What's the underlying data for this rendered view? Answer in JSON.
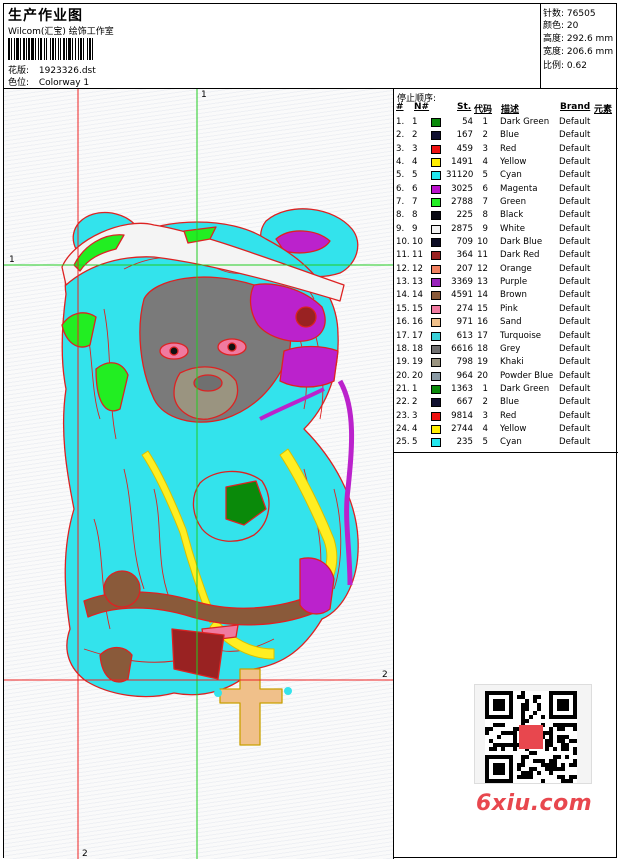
{
  "header": {
    "title": "生产作业图",
    "company": "Wilcom(汇宝) 绘饰工作室",
    "design_label": "花版:",
    "design_value": "1923326.dst",
    "colorway_label": "色位:",
    "colorway_value": "Colorway 1"
  },
  "stats": [
    {
      "label": "针数:",
      "value": "76505"
    },
    {
      "label": "颜色:",
      "value": "20"
    },
    {
      "label": "高度:",
      "value": "292.6 mm"
    },
    {
      "label": "宽度:",
      "value": "206.6 mm"
    },
    {
      "label": "比例:",
      "value": "0.62"
    }
  ],
  "markers": {
    "v1": "1",
    "h1": "1",
    "h2": "2",
    "v2": "2"
  },
  "stop_sequence": {
    "title": "停止顺序:",
    "headers": [
      "#",
      "N#",
      "St.",
      "代码",
      "描述",
      "Brand",
      "元素"
    ],
    "rows": [
      {
        "idx": "1.",
        "n": "1",
        "color": "#0a8a0a",
        "st": "54",
        "code": "1",
        "desc": "Dark Green",
        "brand": "Default"
      },
      {
        "idx": "2.",
        "n": "2",
        "color": "#101030",
        "st": "167",
        "code": "2",
        "desc": "Blue",
        "brand": "Default"
      },
      {
        "idx": "3.",
        "n": "3",
        "color": "#ee1111",
        "st": "459",
        "code": "3",
        "desc": "Red",
        "brand": "Default"
      },
      {
        "idx": "4.",
        "n": "4",
        "color": "#ffee00",
        "st": "1491",
        "code": "4",
        "desc": "Yellow",
        "brand": "Default"
      },
      {
        "idx": "5.",
        "n": "5",
        "color": "#22e6ee",
        "st": "31120",
        "code": "5",
        "desc": "Cyan",
        "brand": "Default"
      },
      {
        "idx": "6.",
        "n": "6",
        "color": "#bb11cc",
        "st": "3025",
        "code": "6",
        "desc": "Magenta",
        "brand": "Default"
      },
      {
        "idx": "7.",
        "n": "7",
        "color": "#22ee22",
        "st": "2788",
        "code": "7",
        "desc": "Green",
        "brand": "Default"
      },
      {
        "idx": "8.",
        "n": "8",
        "color": "#0a0a14",
        "st": "225",
        "code": "8",
        "desc": "Black",
        "brand": "Default"
      },
      {
        "idx": "9.",
        "n": "9",
        "color": "#f4f4f4",
        "st": "2875",
        "code": "9",
        "desc": "White",
        "brand": "Default"
      },
      {
        "idx": "10.",
        "n": "10",
        "color": "#0c0c24",
        "st": "709",
        "code": "10",
        "desc": "Dark Blue",
        "brand": "Default"
      },
      {
        "idx": "11.",
        "n": "11",
        "color": "#992222",
        "st": "364",
        "code": "11",
        "desc": "Dark Red",
        "brand": "Default"
      },
      {
        "idx": "12.",
        "n": "12",
        "color": "#f08060",
        "st": "207",
        "code": "12",
        "desc": "Orange",
        "brand": "Default"
      },
      {
        "idx": "13.",
        "n": "13",
        "color": "#9922bb",
        "st": "3369",
        "code": "13",
        "desc": "Purple",
        "brand": "Default"
      },
      {
        "idx": "14.",
        "n": "14",
        "color": "#8a5a3a",
        "st": "4591",
        "code": "14",
        "desc": "Brown",
        "brand": "Default"
      },
      {
        "idx": "15.",
        "n": "15",
        "color": "#f07aa0",
        "st": "274",
        "code": "15",
        "desc": "Pink",
        "brand": "Default"
      },
      {
        "idx": "16.",
        "n": "16",
        "color": "#f0c08a",
        "st": "971",
        "code": "16",
        "desc": "Sand",
        "brand": "Default"
      },
      {
        "idx": "17.",
        "n": "17",
        "color": "#3ad0d8",
        "st": "613",
        "code": "17",
        "desc": "Turquoise",
        "brand": "Default"
      },
      {
        "idx": "18.",
        "n": "18",
        "color": "#707070",
        "st": "6616",
        "code": "18",
        "desc": "Grey",
        "brand": "Default"
      },
      {
        "idx": "19.",
        "n": "19",
        "color": "#9a9480",
        "st": "798",
        "code": "19",
        "desc": "Khaki",
        "brand": "Default"
      },
      {
        "idx": "20.",
        "n": "20",
        "color": "#8a9aa4",
        "st": "964",
        "code": "20",
        "desc": "Powder Blue",
        "brand": "Default"
      },
      {
        "idx": "21.",
        "n": "1",
        "color": "#0a8a0a",
        "st": "1363",
        "code": "1",
        "desc": "Dark Green",
        "brand": "Default"
      },
      {
        "idx": "22.",
        "n": "2",
        "color": "#101030",
        "st": "667",
        "code": "2",
        "desc": "Blue",
        "brand": "Default"
      },
      {
        "idx": "23.",
        "n": "3",
        "color": "#ee1111",
        "st": "9814",
        "code": "3",
        "desc": "Red",
        "brand": "Default"
      },
      {
        "idx": "24.",
        "n": "4",
        "color": "#ffee00",
        "st": "2744",
        "code": "4",
        "desc": "Yellow",
        "brand": "Default"
      },
      {
        "idx": "25.",
        "n": "5",
        "color": "#22e6ee",
        "st": "235",
        "code": "5",
        "desc": "Cyan",
        "brand": "Default"
      }
    ]
  },
  "watermark": {
    "text": "6xiu.com"
  }
}
